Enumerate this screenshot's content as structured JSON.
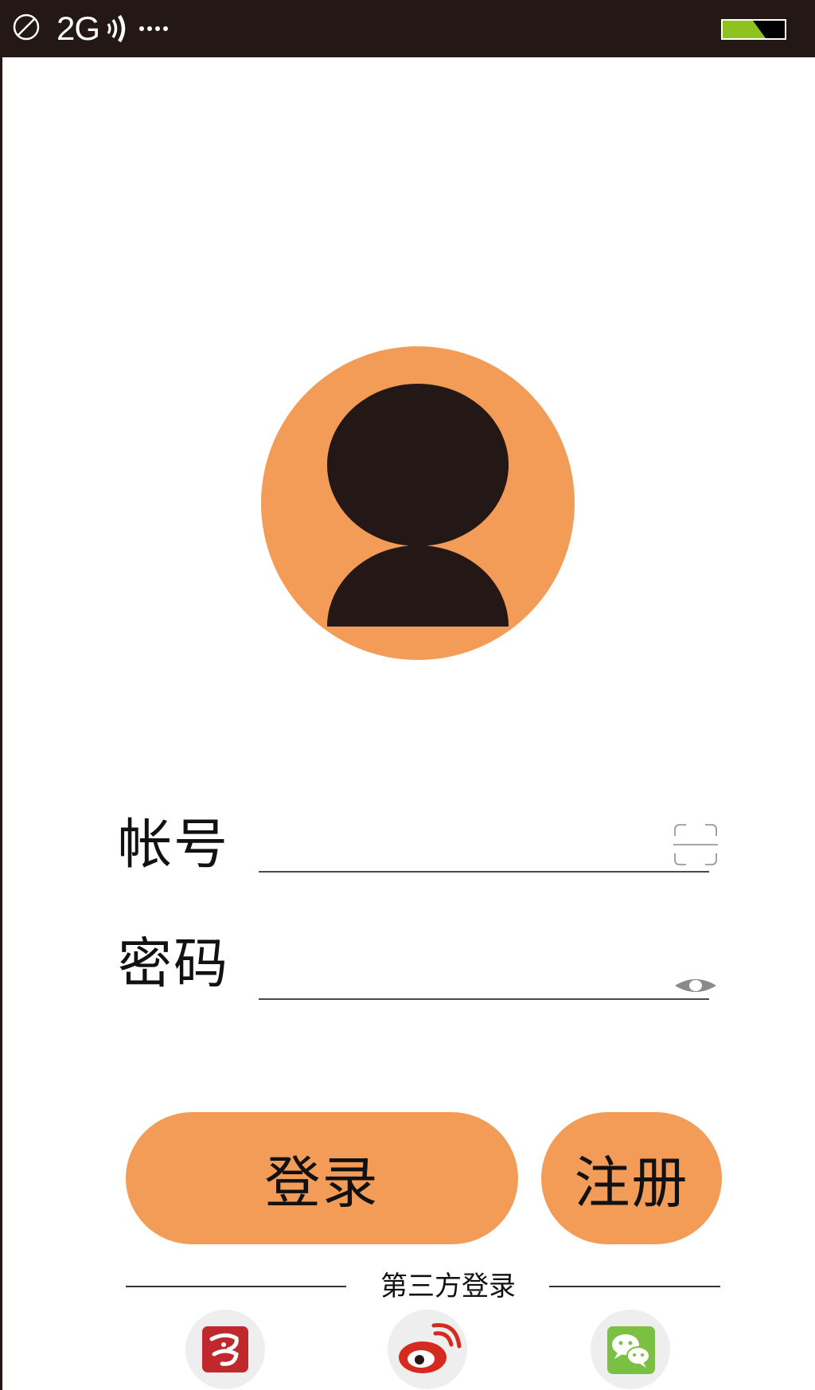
{
  "status_bar": {
    "network": "2G",
    "icons": [
      "no-sim-icon",
      "signal-icon",
      "battery-icon"
    ],
    "battery_color": "#8dc21f",
    "background": "#231815"
  },
  "avatar": {
    "icon": "user-avatar-icon",
    "circle_color": "#f29c58",
    "figure_color": "#231815"
  },
  "form": {
    "account_label": "帐号",
    "account_value": "",
    "account_icon": "scan-icon",
    "password_label": "密码",
    "password_value": "",
    "password_icon": "eye-icon"
  },
  "buttons": {
    "login": "登录",
    "register": "注册",
    "color": "#f29c58"
  },
  "third_party": {
    "label": "第三方登录",
    "providers": [
      {
        "icon": "yixin-icon",
        "color": "#c0282d"
      },
      {
        "icon": "weibo-icon",
        "color": "#d52b1e"
      },
      {
        "icon": "wechat-icon",
        "color": "#7bc043"
      }
    ]
  }
}
